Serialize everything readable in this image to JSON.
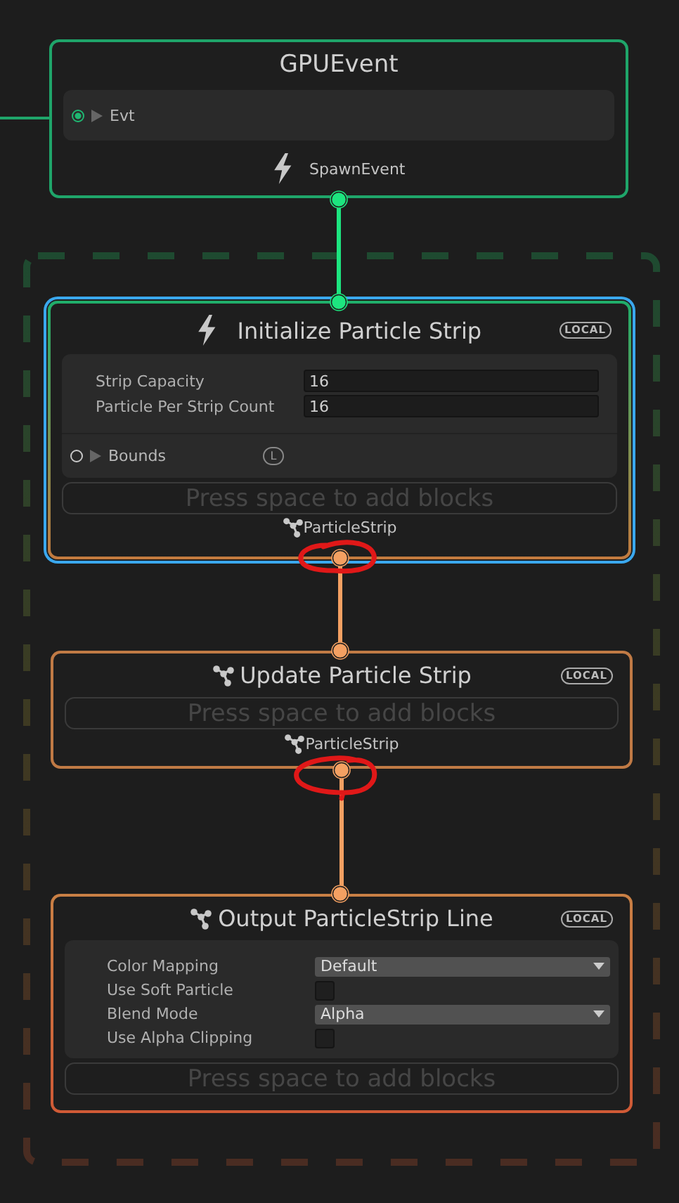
{
  "nodes": [
    {
      "kind": "event",
      "title": "GPUEvent",
      "inputs": [
        {
          "label": "Evt",
          "connected": true
        }
      ],
      "output": {
        "label": "SpawnEvent"
      }
    },
    {
      "kind": "initialize",
      "title": "Initialize Particle Strip",
      "badge": "LOCAL",
      "selected": true,
      "settings": [
        {
          "kind": "number",
          "label": "Strip Capacity",
          "value": "16"
        },
        {
          "kind": "number",
          "label": "Particle Per Strip Count",
          "value": "16"
        }
      ],
      "properties": [
        {
          "label": "Bounds",
          "badge": "L",
          "connected": false
        }
      ],
      "placeholder": "Press space to add blocks",
      "output": {
        "label": "ParticleStrip"
      }
    },
    {
      "kind": "update",
      "title": "Update Particle Strip",
      "badge": "LOCAL",
      "selected": false,
      "placeholder": "Press space to add blocks",
      "output": {
        "label": "ParticleStrip"
      }
    },
    {
      "kind": "output",
      "title": "Output ParticleStrip Line",
      "badge": "LOCAL",
      "selected": false,
      "settings": [
        {
          "kind": "dropdown",
          "label": "Color Mapping",
          "value": "Default"
        },
        {
          "kind": "checkbox",
          "label": "Use Soft Particle",
          "checked": false
        },
        {
          "kind": "dropdown",
          "label": "Blend Mode",
          "value": "Alpha"
        },
        {
          "kind": "checkbox",
          "label": "Use Alpha Clipping",
          "checked": false
        }
      ],
      "placeholder": "Press space to add blocks"
    }
  ]
}
